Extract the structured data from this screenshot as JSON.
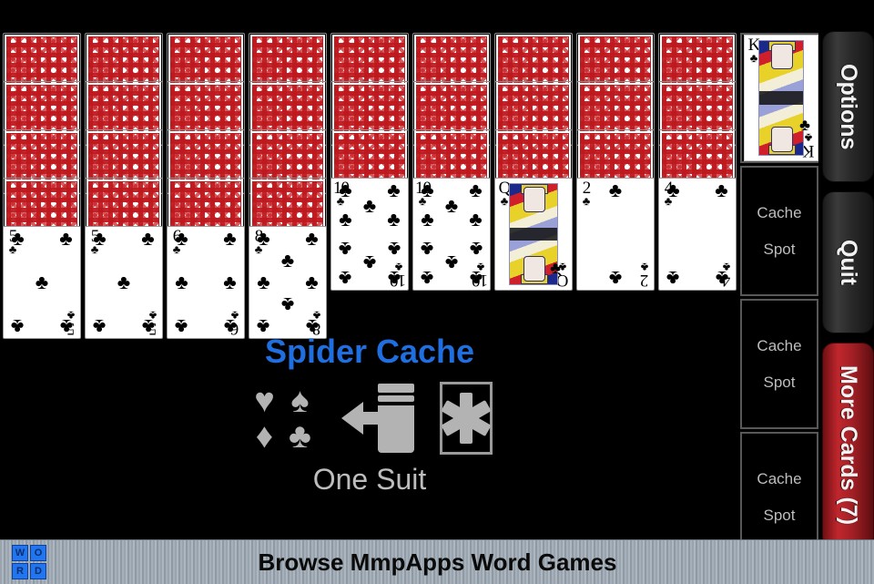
{
  "app": {
    "title": "Spider Cache",
    "subtitle": "One Suit",
    "title_color": "#1f6fe0",
    "background_color": "#000000"
  },
  "logo": {
    "suits": [
      "♥",
      "♠",
      "♦",
      "♣"
    ],
    "suit_icon_name": "four-suits-icon",
    "deal_icon_name": "deal-arrow-icon",
    "wild_icon_name": "wild-card-asterisk-icon",
    "wild_glyph": "✲"
  },
  "tableau": {
    "columns": [
      {
        "index": 1,
        "facedown": 4,
        "faceup": [
          {
            "rank": "5",
            "suit": "♣",
            "pips": 5
          }
        ]
      },
      {
        "index": 2,
        "facedown": 4,
        "faceup": [
          {
            "rank": "5",
            "suit": "♣",
            "pips": 5
          }
        ]
      },
      {
        "index": 3,
        "facedown": 4,
        "faceup": [
          {
            "rank": "6",
            "suit": "♣",
            "pips": 6
          }
        ]
      },
      {
        "index": 4,
        "facedown": 4,
        "faceup": [
          {
            "rank": "8",
            "suit": "♣",
            "pips": 8
          }
        ]
      },
      {
        "index": 5,
        "facedown": 3,
        "faceup": [
          {
            "rank": "10",
            "suit": "♣",
            "pips": 10
          }
        ]
      },
      {
        "index": 6,
        "facedown": 3,
        "faceup": [
          {
            "rank": "10",
            "suit": "♣",
            "pips": 10
          }
        ]
      },
      {
        "index": 7,
        "facedown": 3,
        "faceup": [
          {
            "rank": "Q",
            "suit": "♣",
            "pips": 0,
            "court": true
          }
        ]
      },
      {
        "index": 8,
        "facedown": 3,
        "faceup": [
          {
            "rank": "2",
            "suit": "♣",
            "pips": 2
          }
        ]
      },
      {
        "index": 9,
        "facedown": 3,
        "faceup": [
          {
            "rank": "4",
            "suit": "♣",
            "pips": 4
          }
        ]
      }
    ],
    "card_back_color": "#be191e"
  },
  "foundation": {
    "card": {
      "rank": "K",
      "suit": "♣",
      "court": true
    }
  },
  "cache_spots": [
    {
      "label": "Cache\nSpot",
      "line1": "Cache",
      "line2": "Spot"
    },
    {
      "label": "Cache\nSpot",
      "line1": "Cache",
      "line2": "Spot"
    },
    {
      "label": "Cache\nSpot",
      "line1": "Cache",
      "line2": "Spot"
    }
  ],
  "side_buttons": [
    {
      "label": "Options",
      "style": "dark"
    },
    {
      "label": "Quit",
      "style": "dark"
    },
    {
      "label": "More Cards (7)",
      "style": "red",
      "color": "#c0272d",
      "remaining": 7
    }
  ],
  "banner": {
    "text": "Browse MmpApps Word Games",
    "logo_letters": [
      "W",
      "O",
      "R",
      "D"
    ],
    "logo_color": "#2176ef"
  }
}
